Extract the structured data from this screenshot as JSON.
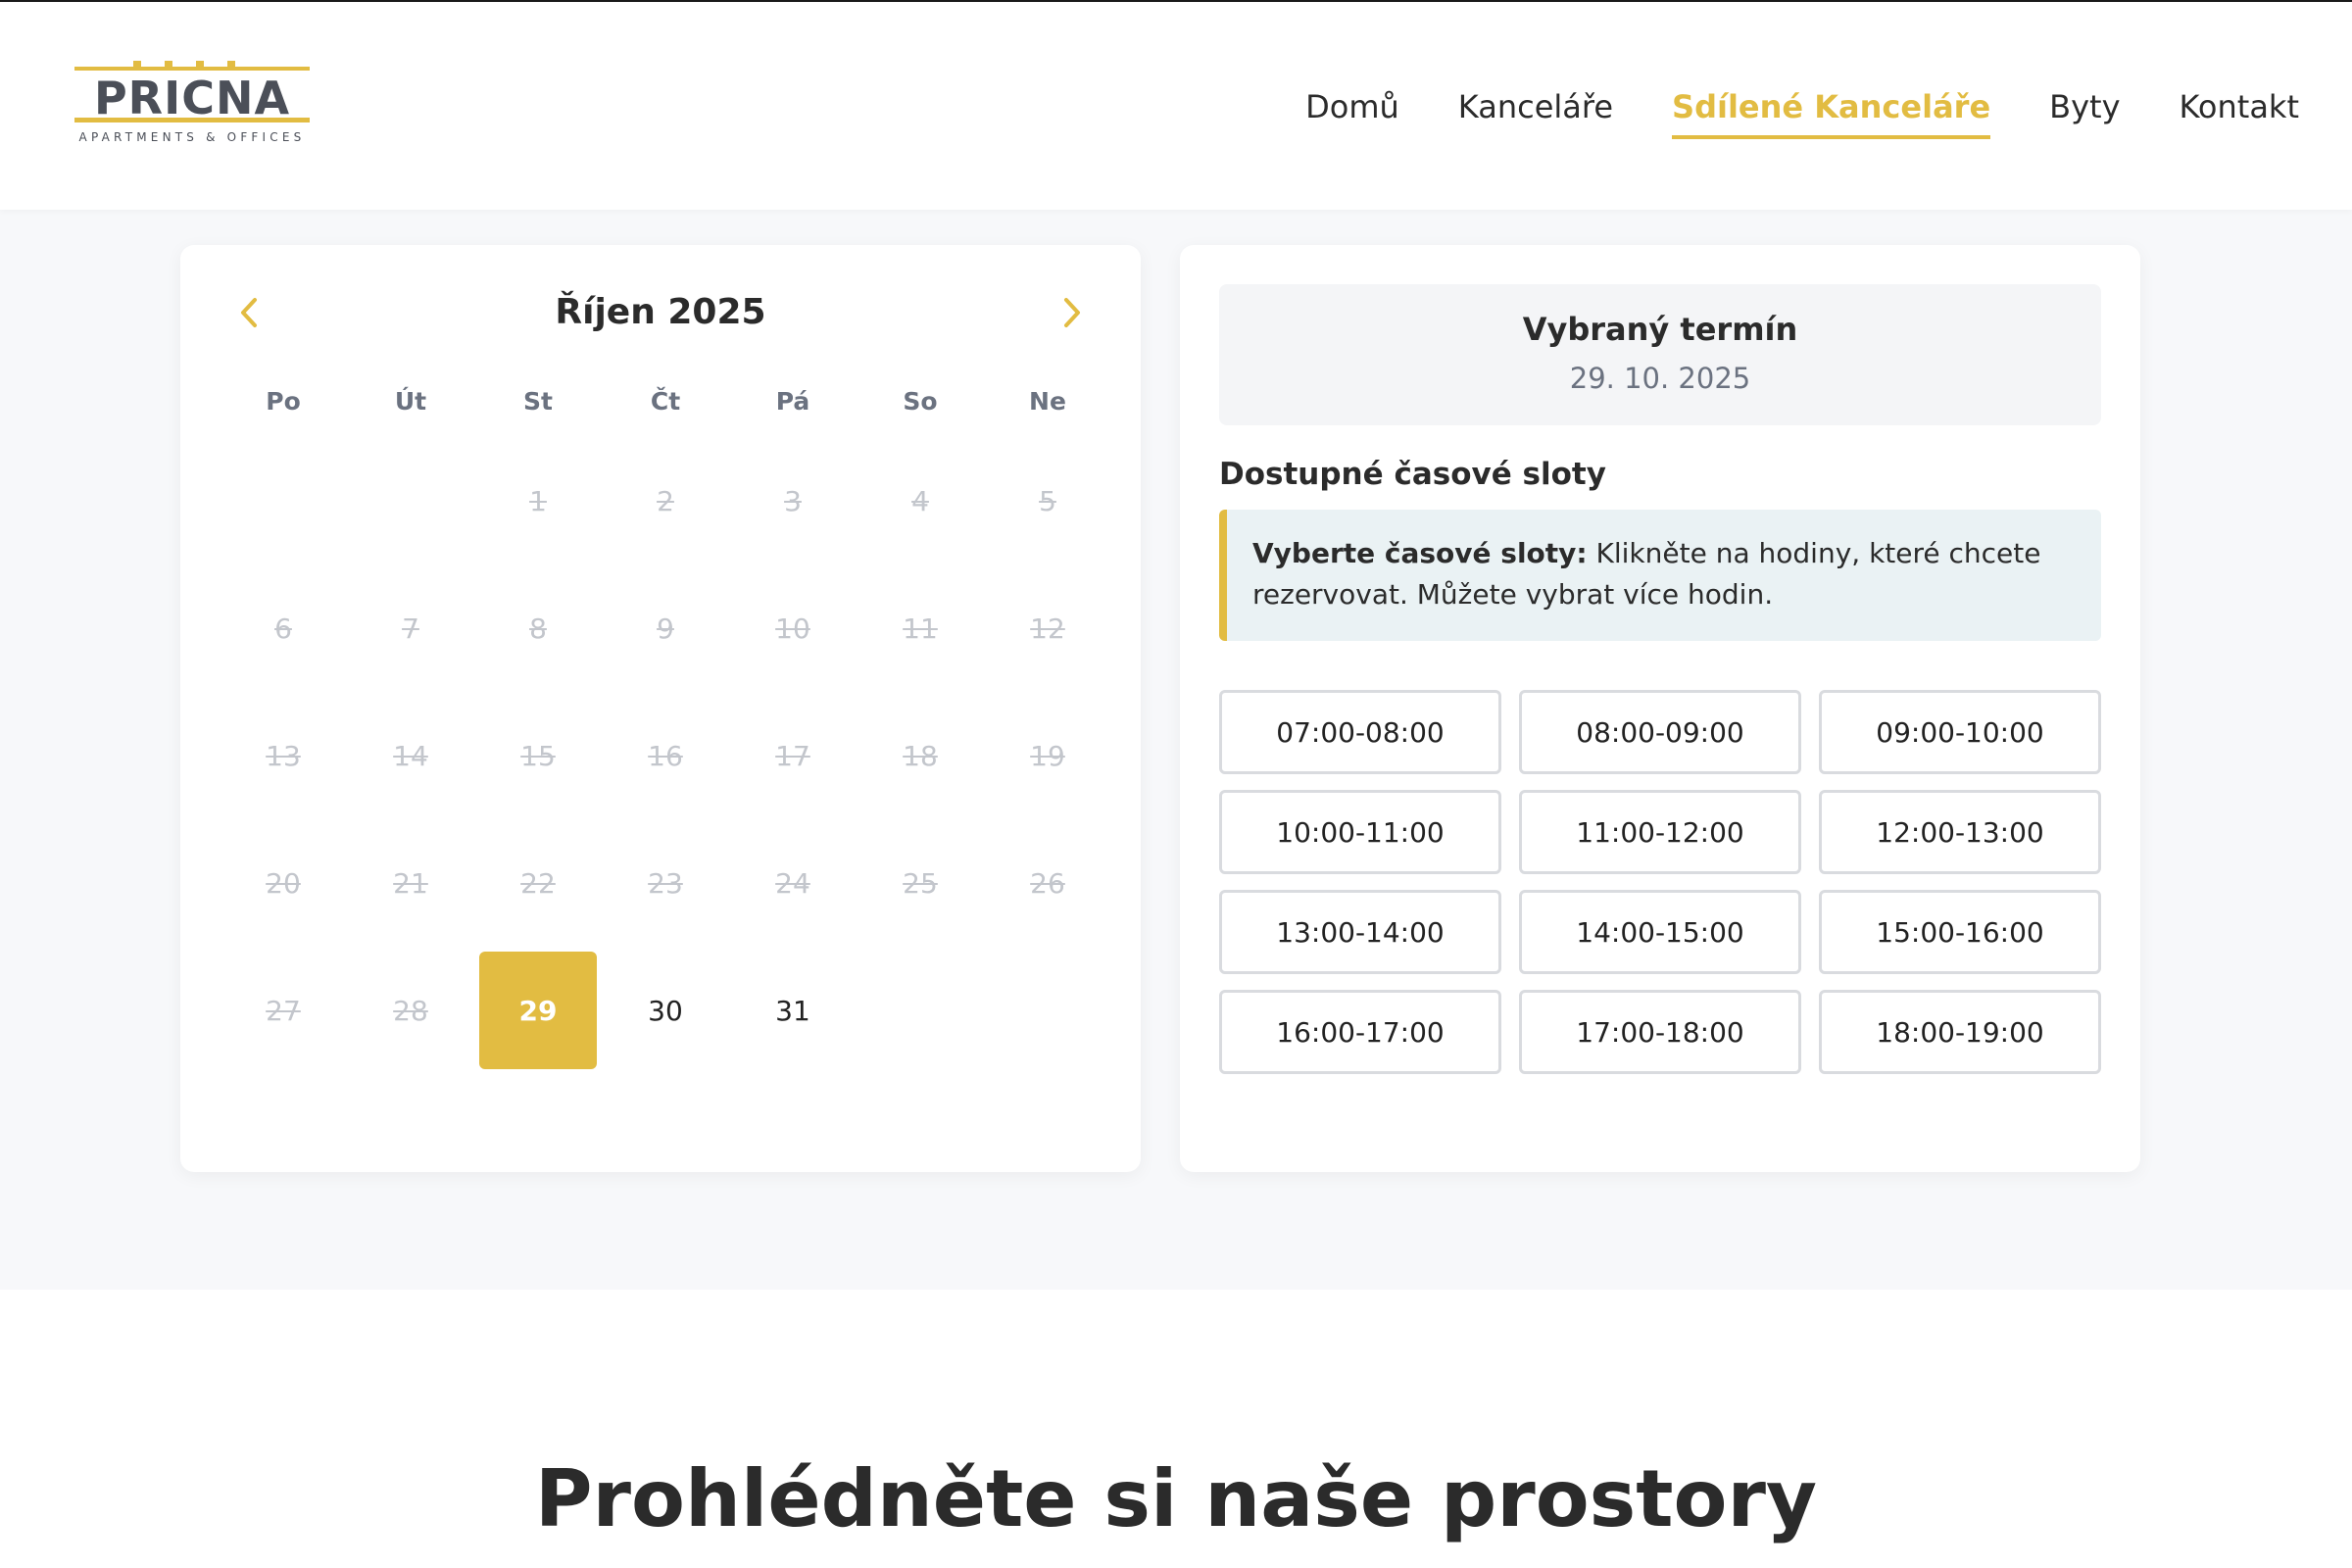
{
  "brand": {
    "name": "PRICNA",
    "tagline": "APARTMENTS & OFFICES",
    "accent_color": "#e2bc42"
  },
  "nav": {
    "items": [
      {
        "label": "Domů",
        "active": false
      },
      {
        "label": "Kanceláře",
        "active": false
      },
      {
        "label": "Sdílené Kanceláře",
        "active": true
      },
      {
        "label": "Byty",
        "active": false
      },
      {
        "label": "Kontakt",
        "active": false
      }
    ]
  },
  "calendar": {
    "month_title": "Říjen 2025",
    "prev_icon": "chevron-left-icon",
    "next_icon": "chevron-right-icon",
    "weekdays": [
      "Po",
      "Út",
      "St",
      "Čt",
      "Pá",
      "So",
      "Ne"
    ],
    "leading_blanks": 2,
    "days": [
      {
        "n": "1",
        "state": "disabled"
      },
      {
        "n": "2",
        "state": "disabled"
      },
      {
        "n": "3",
        "state": "disabled"
      },
      {
        "n": "4",
        "state": "disabled"
      },
      {
        "n": "5",
        "state": "disabled"
      },
      {
        "n": "6",
        "state": "disabled"
      },
      {
        "n": "7",
        "state": "disabled"
      },
      {
        "n": "8",
        "state": "disabled"
      },
      {
        "n": "9",
        "state": "disabled"
      },
      {
        "n": "10",
        "state": "disabled"
      },
      {
        "n": "11",
        "state": "disabled"
      },
      {
        "n": "12",
        "state": "disabled"
      },
      {
        "n": "13",
        "state": "disabled"
      },
      {
        "n": "14",
        "state": "disabled"
      },
      {
        "n": "15",
        "state": "disabled"
      },
      {
        "n": "16",
        "state": "disabled"
      },
      {
        "n": "17",
        "state": "disabled"
      },
      {
        "n": "18",
        "state": "disabled"
      },
      {
        "n": "19",
        "state": "disabled"
      },
      {
        "n": "20",
        "state": "disabled"
      },
      {
        "n": "21",
        "state": "disabled"
      },
      {
        "n": "22",
        "state": "disabled"
      },
      {
        "n": "23",
        "state": "disabled"
      },
      {
        "n": "24",
        "state": "disabled"
      },
      {
        "n": "25",
        "state": "disabled"
      },
      {
        "n": "26",
        "state": "disabled"
      },
      {
        "n": "27",
        "state": "disabled"
      },
      {
        "n": "28",
        "state": "disabled"
      },
      {
        "n": "29",
        "state": "selected"
      },
      {
        "n": "30",
        "state": "available"
      },
      {
        "n": "31",
        "state": "available"
      }
    ]
  },
  "selection": {
    "title": "Vybraný termín",
    "date": "29. 10. 2025"
  },
  "slots_section": {
    "heading": "Dostupné časové sloty",
    "info_bold": "Vyberte časové sloty:",
    "info_text": " Klikněte na hodiny, které chcete rezervovat. Můžete vybrat více hodin.",
    "slots": [
      "07:00-08:00",
      "08:00-09:00",
      "09:00-10:00",
      "10:00-11:00",
      "11:00-12:00",
      "12:00-13:00",
      "13:00-14:00",
      "14:00-15:00",
      "15:00-16:00",
      "16:00-17:00",
      "17:00-18:00",
      "18:00-19:00"
    ]
  },
  "lower": {
    "title": "Prohlédněte si naše prostory"
  }
}
